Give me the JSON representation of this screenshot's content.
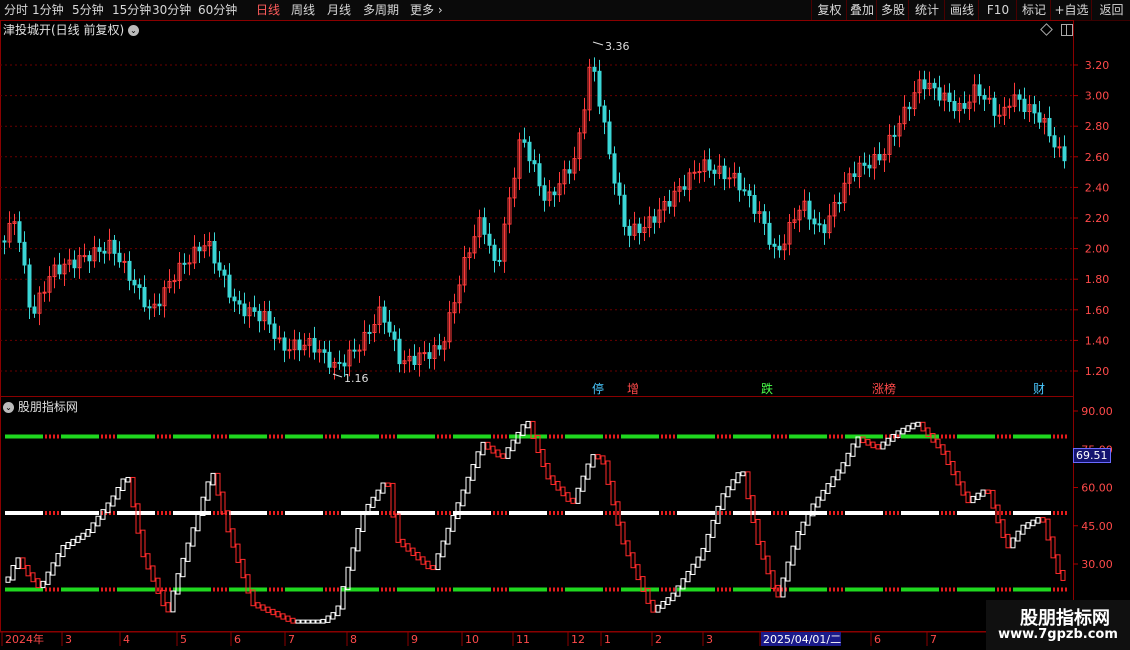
{
  "toolbar": {
    "periods": [
      "分时",
      "1分钟",
      "5分钟",
      "15分钟",
      "30分钟",
      "60分钟",
      "日线",
      "周线",
      "月线",
      "多周期",
      "更多 ›"
    ],
    "active": "日线",
    "right_buttons": [
      "复权",
      "叠加",
      "多股",
      "统计",
      "画线",
      "F10",
      "标记",
      "+自选",
      "返回"
    ]
  },
  "title": "津投城开(日线 前复权)",
  "main_panel": {
    "y_ticks": [
      "3.20",
      "3.00",
      "2.80",
      "2.60",
      "2.40",
      "2.20",
      "2.00",
      "1.80",
      "1.60",
      "1.40",
      "1.20"
    ],
    "high_label": "3.36",
    "low_label": "1.16",
    "event_markers": [
      {
        "label": "停",
        "color": "#4ac8ff"
      },
      {
        "label": "增",
        "color": "#ff4a4a"
      },
      {
        "label": "跌",
        "color": "#4aff4a"
      },
      {
        "label": "涨榜",
        "color": "#ff4a4a"
      },
      {
        "label": "财",
        "color": "#4ac8ff"
      }
    ]
  },
  "indicator_panel": {
    "name": "股朋指标网",
    "y_ticks": [
      "90.00",
      "75.00",
      "60.00",
      "45.00",
      "30.00"
    ],
    "current_value": "69.51",
    "levels": [
      80,
      50,
      20
    ]
  },
  "x_axis": {
    "labels": [
      "2024年",
      "3",
      "4",
      "5",
      "6",
      "7",
      "8",
      "9",
      "10",
      "11",
      "12",
      "1",
      "2",
      "3",
      "2025/04/01/二",
      "6",
      "7"
    ],
    "highlight": "2025/04/01/二"
  },
  "watermark": {
    "line1": "股朋指标网",
    "line2": "www.7gpzb.com"
  },
  "colors": {
    "up": "#ff3b3b",
    "down": "#3ad6d6",
    "green_line": "#1fd81f",
    "white_line": "#ffffff",
    "grid": "#8a0000"
  },
  "chart_data": {
    "type": "candlestick",
    "price_min": 1.16,
    "price_max": 3.36,
    "indicator_range": [
      0,
      100
    ]
  }
}
